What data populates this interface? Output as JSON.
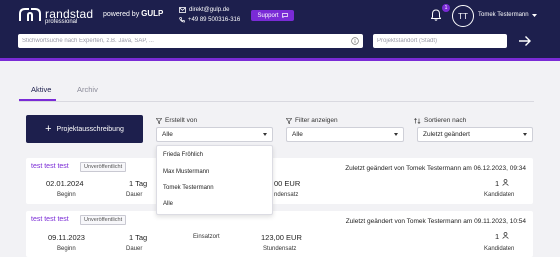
{
  "header": {
    "logo_name": "randstad",
    "logo_sub": "professional",
    "powered_prefix": "powered by",
    "powered_brand": "GULP",
    "email": "direkt@gulp.de",
    "phone": "+49 89 500316-316",
    "support_label": "Support",
    "notification_count": "1",
    "avatar_initials": "TT",
    "user_name": "Tomek Testermann"
  },
  "search": {
    "placeholder": "Stichwortsuche nach Experten, z.B. Java, SAP, ...",
    "location_placeholder": "Projektstandort (Stadt)"
  },
  "tabs": [
    {
      "label": "Aktive",
      "active": true
    },
    {
      "label": "Archiv",
      "active": false
    }
  ],
  "toolbar": {
    "create_label": "Projektausschreibung"
  },
  "filters": {
    "created_by": {
      "label": "Erstellt von",
      "value": "Alle"
    },
    "show": {
      "label": "Filter anzeigen",
      "value": "Alle"
    },
    "sort": {
      "label": "Sortieren nach",
      "value": "Zuletzt geändert"
    }
  },
  "dropdown": {
    "options": [
      "Frieda Fröhlich",
      "Max Mustermann",
      "Tomek Testermann",
      "Alle"
    ]
  },
  "projects": [
    {
      "title": "test test test",
      "status": "Unveröffentlicht",
      "changed": "Zuletzt geändert von Tomek Testermann am 06.12.2023, 09:34",
      "start_date": "02.01.2024",
      "start_label": "Beginn",
      "duration": "1 Tag",
      "duration_label": "Dauer",
      "location": "",
      "location_label": "",
      "rate": "00 EUR",
      "rate_label": "ndensatz",
      "candidates": "1",
      "candidates_label": "Kandidaten"
    },
    {
      "title": "test test test",
      "status": "Unveröffentlicht",
      "changed": "Zuletzt geändert von Tomek Testermann am 09.11.2023, 10:54",
      "start_date": "09.11.2023",
      "start_label": "Beginn",
      "duration": "1 Tag",
      "duration_label": "Dauer",
      "location": "",
      "location_label": "Einsatzort",
      "rate": "123,00 EUR",
      "rate_label": "Stundensatz",
      "candidates": "1",
      "candidates_label": "Kandidaten"
    }
  ],
  "colors": {
    "navy": "#1d1f4d",
    "purple": "#7a2bd6"
  }
}
